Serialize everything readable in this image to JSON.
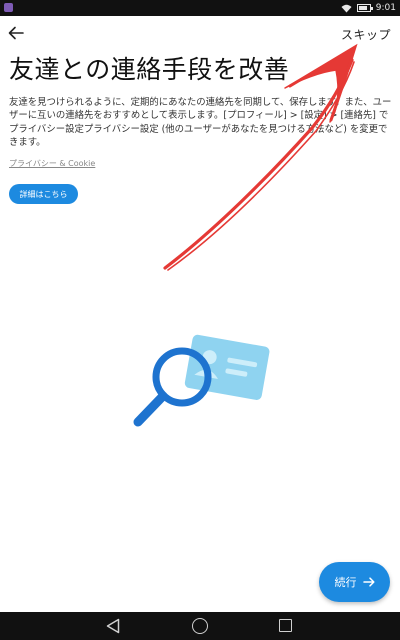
{
  "status_bar": {
    "time": "9:01",
    "icons": [
      "app-notification-icon",
      "wifi-icon",
      "battery-icon"
    ]
  },
  "header": {
    "back_icon": "back-arrow-icon",
    "skip_label": "スキップ"
  },
  "main": {
    "title": "友達との連絡手段を改善",
    "description": "友達を見つけられるように、定期的にあなたの連絡先を同期して、保存します。また、ユーザーに互いの連絡先をおすすめとして表示します。[プロフィール] > [設定] > [連絡先] でプライバシー設定プライバシー設定 (他のユーザーがあなたを見つける方法など) を変更できます。",
    "privacy_link": "プライバシー & Cookie",
    "details_button": "詳細はこちら",
    "illustration": "magnifier-contact-card-icon"
  },
  "footer": {
    "continue_label": "続行",
    "continue_icon": "arrow-right-icon"
  },
  "nav_bar": {
    "icons": [
      "nav-back-icon",
      "nav-home-icon",
      "nav-recents-icon"
    ]
  },
  "colors": {
    "accent": "#1d8ae0",
    "annotation": "#e53935",
    "bars": "#111111"
  }
}
